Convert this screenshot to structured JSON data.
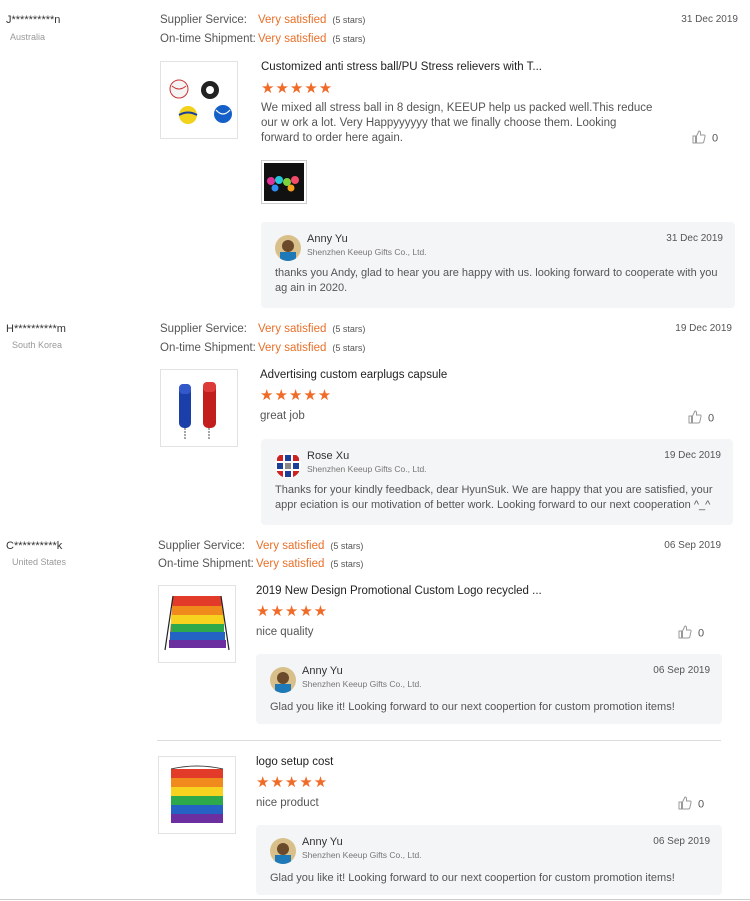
{
  "reviews": [
    {
      "buyer": "J**********n",
      "country": "Australia",
      "date": "31 Dec 2019",
      "supplier_service": {
        "label": "Supplier Service:",
        "value": "Very satisfied",
        "stars": "(5 stars)"
      },
      "shipment": {
        "label": "On-time Shipment:",
        "value": "Very satisfied",
        "stars": "(5 stars)"
      },
      "items": [
        {
          "title": "Customized anti stress ball/PU Stress relievers with T...",
          "stars": "★★★★★",
          "text": "We mixed all stress ball in 8 design, KEEUP help us packed well.This reduce our w ork a lot. Very Happyyyyyy that we finally choose them. Looking forward to order here again.",
          "likes": "0",
          "reply": {
            "name": "Anny Yu",
            "company": "Shenzhen Keeup Gifts Co., Ltd.",
            "date": "31 Dec 2019",
            "text": "thanks you Andy, glad to hear you are happy with us. looking forward to cooperate with you ag ain in 2020."
          }
        }
      ]
    },
    {
      "buyer": "H**********m",
      "country": "South Korea",
      "date": "19 Dec 2019",
      "supplier_service": {
        "label": "Supplier Service:",
        "value": "Very satisfied",
        "stars": "(5 stars)"
      },
      "shipment": {
        "label": "On-time Shipment:",
        "value": "Very satisfied",
        "stars": "(5 stars)"
      },
      "items": [
        {
          "title": "Advertising custom earplugs capsule",
          "stars": "★★★★★",
          "text": "great job",
          "likes": "0",
          "reply": {
            "name": "Rose Xu",
            "company": "Shenzhen Keeup Gifts Co., Ltd.",
            "date": "19 Dec 2019",
            "text": "Thanks for your kindly feedback, dear HyunSuk. We are happy that you are satisfied, your appr eciation is our motivation of better work. Looking forward to our next cooperation ^_^"
          }
        }
      ]
    },
    {
      "buyer": "C**********k",
      "country": "United States",
      "date": "06 Sep 2019",
      "supplier_service": {
        "label": "Supplier Service:",
        "value": "Very satisfied",
        "stars": "(5 stars)"
      },
      "shipment": {
        "label": "On-time Shipment:",
        "value": "Very satisfied",
        "stars": "(5 stars)"
      },
      "items": [
        {
          "title": "2019 New Design Promotional Custom Logo recycled ...",
          "stars": "★★★★★",
          "text": "nice quality",
          "likes": "0",
          "reply": {
            "name": "Anny Yu",
            "company": "Shenzhen Keeup Gifts Co., Ltd.",
            "date": "06 Sep 2019",
            "text": "Glad you like it! Looking forward to our next coopertion for custom promotion items!"
          }
        },
        {
          "title": "logo setup cost",
          "stars": "★★★★★",
          "text": "nice product",
          "likes": "0",
          "reply": {
            "name": "Anny Yu",
            "company": "Shenzhen Keeup Gifts Co., Ltd.",
            "date": "06 Sep 2019",
            "text": "Glad you like it! Looking forward to our next coopertion for custom promotion items!"
          }
        }
      ]
    }
  ],
  "icons": {
    "like": "thumbs-up-icon"
  },
  "colors": {
    "accent": "#e8702a",
    "stars": "#f06a28",
    "reply_bg": "#f4f5f7"
  }
}
